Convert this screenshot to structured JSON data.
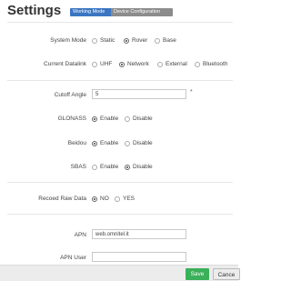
{
  "header": {
    "title": "Settings",
    "tabs": [
      {
        "label": "Working Mode",
        "active": true
      },
      {
        "label": "Device Configuration",
        "active": false
      }
    ]
  },
  "system_mode": {
    "label": "System Mode",
    "options": [
      "Static",
      "Rover",
      "Base"
    ],
    "selected": "Rover"
  },
  "current_datalink": {
    "label": "Current Datalink",
    "options": [
      "UHF",
      "Network",
      "External",
      "Bluetooth"
    ],
    "selected": "Network"
  },
  "cutoff_angle": {
    "label": "Cutoff Angle",
    "value": "5",
    "required_mark": "*"
  },
  "glonass": {
    "label": "GLONASS",
    "options": [
      "Enable",
      "Disable"
    ],
    "selected": "Enable"
  },
  "beidou": {
    "label": "Beidou",
    "options": [
      "Enable",
      "Disable"
    ],
    "selected": "Enable"
  },
  "sbas": {
    "label": "SBAS",
    "options": [
      "Enable",
      "Disable"
    ],
    "selected": "Disable"
  },
  "record_raw_data": {
    "label": "Recoed Raw Data",
    "options": [
      "NO",
      "YES"
    ],
    "selected": "NO"
  },
  "apn": {
    "label": "APN",
    "value": "web.omnitel.it"
  },
  "apn_user": {
    "label": "APN User",
    "value": ""
  },
  "footer": {
    "save_label": "Save",
    "cancel_label": "Cance"
  },
  "colors": {
    "tab_active": "#3a76c2",
    "tab_inactive": "#8c8c8c",
    "save": "#3bb05a"
  }
}
